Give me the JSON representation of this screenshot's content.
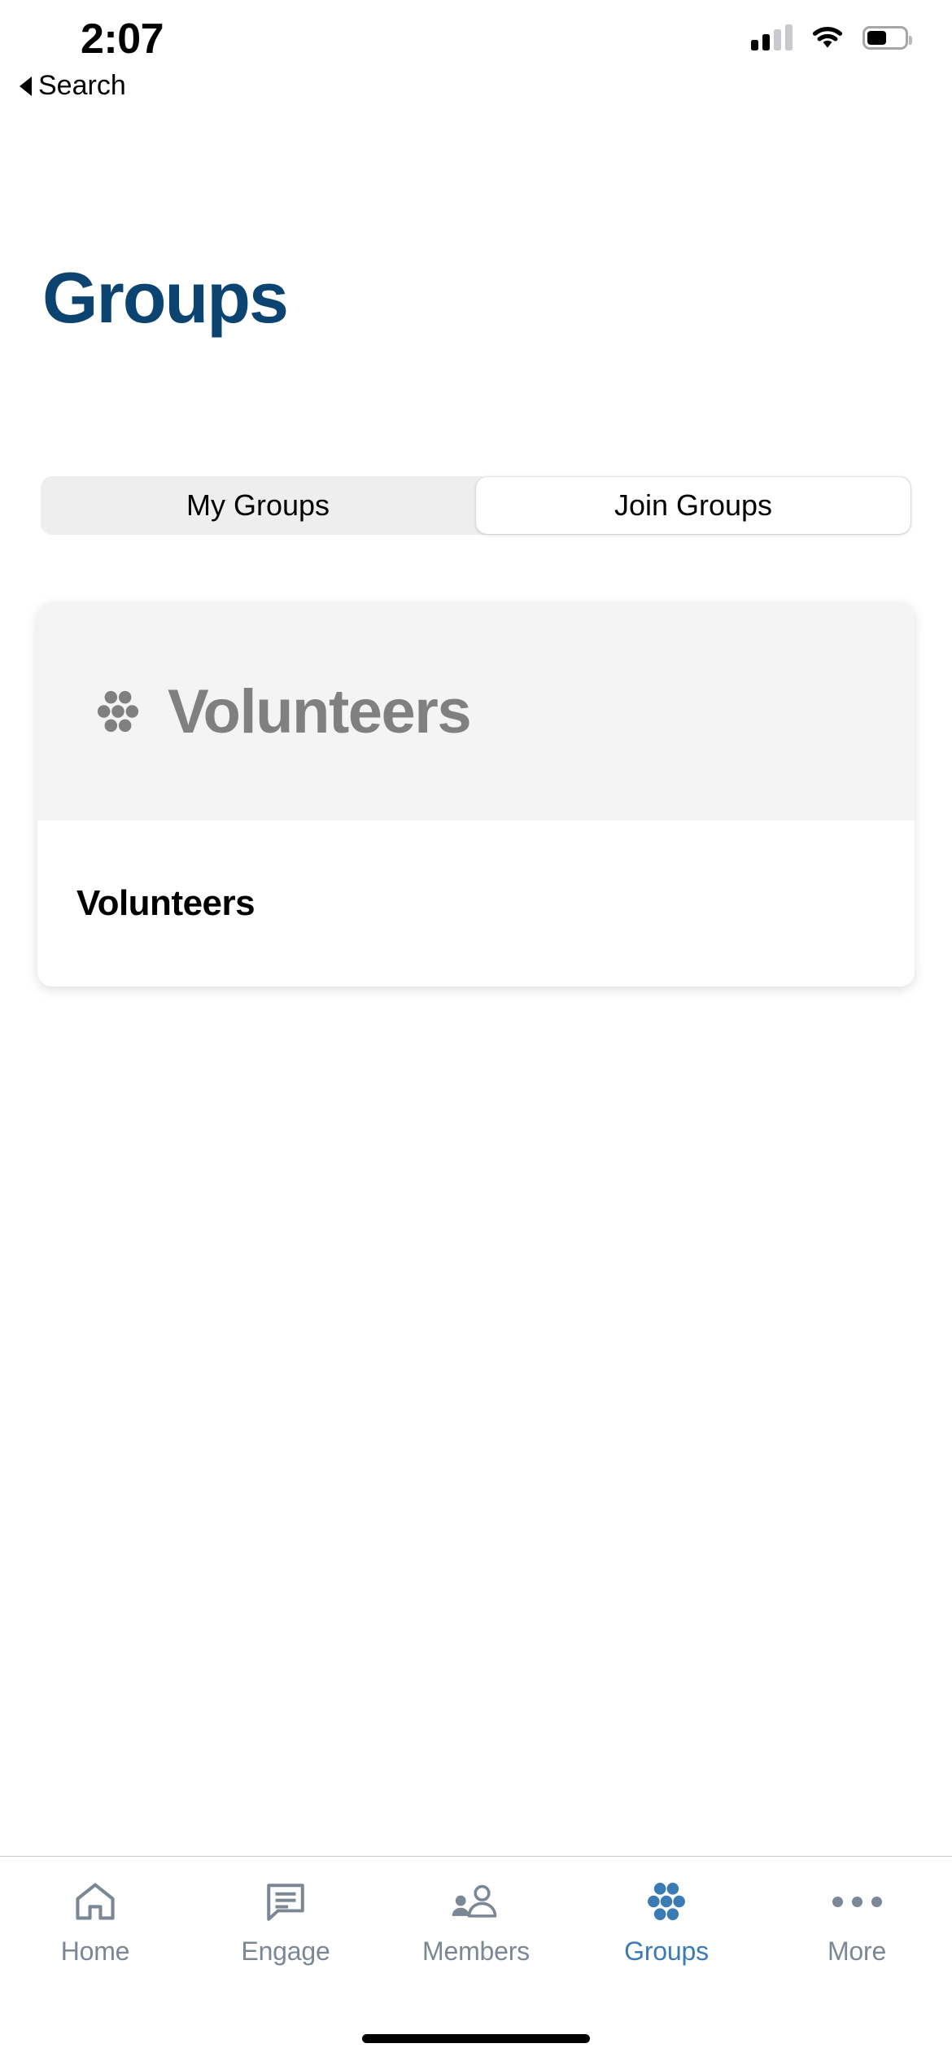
{
  "status_bar": {
    "time": "2:07",
    "back_label": "Search",
    "cellular_icon": "cellular-bars-icon",
    "wifi_icon": "wifi-icon",
    "battery_icon": "battery-icon",
    "battery_level_percent": 52,
    "cellular_bars_active": 2
  },
  "header": {
    "title": "Groups",
    "title_color": "#0b4471"
  },
  "segmented_control": {
    "segments": [
      {
        "label": "My Groups",
        "selected": false
      },
      {
        "label": "Join Groups",
        "selected": true
      }
    ],
    "track_color": "#eeeeef",
    "selected_color": "#ffffff"
  },
  "group_card": {
    "header_icon": "group-dots-icon",
    "header_title": "Volunteers",
    "header_title_color": "#808080",
    "header_background": "#f4f4f4",
    "body_title": "Volunteers",
    "body_title_color": "#000000"
  },
  "tab_bar": {
    "accent_color": "#3b7bb5",
    "inactive_color": "#7b8795",
    "items": [
      {
        "label": "Home",
        "icon": "home-icon",
        "active": false
      },
      {
        "label": "Engage",
        "icon": "chat-bubble-icon",
        "active": false
      },
      {
        "label": "Members",
        "icon": "people-icon",
        "active": false
      },
      {
        "label": "Groups",
        "icon": "group-dots-icon",
        "active": true
      },
      {
        "label": "More",
        "icon": "ellipsis-icon",
        "active": false
      }
    ]
  }
}
